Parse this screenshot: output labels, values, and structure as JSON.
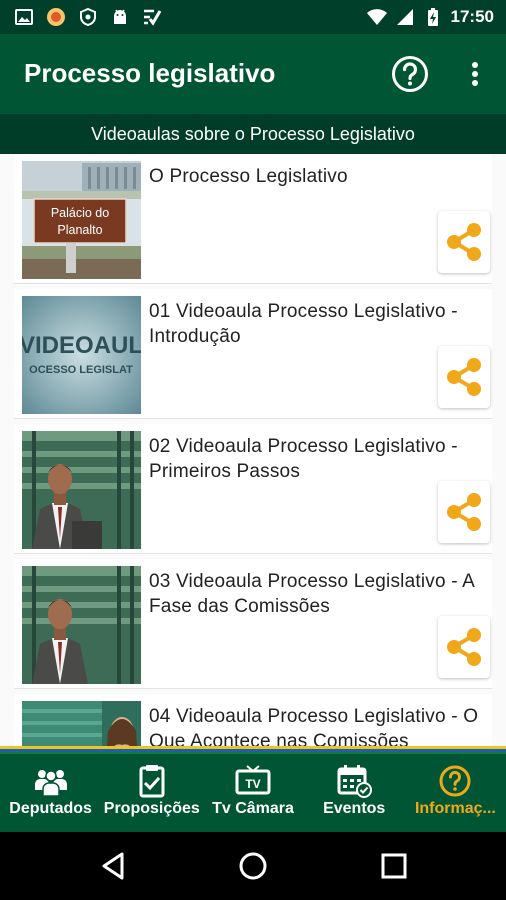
{
  "status_bar": {
    "time": "17:50",
    "left_icons": [
      "image-icon",
      "notification-badge-icon",
      "shield-icon",
      "android-icon",
      "check-app-icon"
    ],
    "right_icons": [
      "wifi-icon",
      "signal-icon",
      "battery-charging-icon"
    ]
  },
  "app_bar": {
    "title": "Processo legislativo",
    "actions": [
      "help-circle-icon",
      "overflow-menu-icon"
    ]
  },
  "section_header": "Videoaulas sobre o Processo Legislativo",
  "videos": [
    {
      "title": "O Processo Legislativo",
      "thumbnail": "palacio-planalto",
      "thumb_text_1": "Palácio do",
      "thumb_text_2": "Planalto"
    },
    {
      "title": "01 Videoaula Processo Legislativo - Introdução",
      "thumbnail": "videoaula-title",
      "thumb_text_1": "VIDEOAUL",
      "thumb_text_2": "OCESSO LEGISLAT"
    },
    {
      "title": "02 Videoaula Processo Legislativo - Primeiros Passos",
      "thumbnail": "presenter"
    },
    {
      "title": "03 Videoaula Processo Legislativo - A Fase das Comissões",
      "thumbnail": "presenter"
    },
    {
      "title": "04 Videoaula Processo Legislativo - O Que Acontece nas Comissões",
      "thumbnail": "presenter-female"
    }
  ],
  "bottom_nav": {
    "active_index": 4,
    "active_color": "#f0a81a",
    "items": [
      {
        "label": "Deputados",
        "icon": "deputies-icon"
      },
      {
        "label": "Proposições",
        "icon": "clipboard-check-icon"
      },
      {
        "label": "Tv Câmara",
        "icon": "tv-icon"
      },
      {
        "label": "Eventos",
        "icon": "calendar-check-icon"
      },
      {
        "label": "Informaç...",
        "icon": "help-circle-icon"
      }
    ]
  },
  "system_nav": [
    "back-icon",
    "home-icon",
    "recents-icon"
  ],
  "colors": {
    "status_bar": "#00402a",
    "app_bar": "#005634",
    "sub_header": "#003d29",
    "share_accent": "#f0a81a"
  }
}
